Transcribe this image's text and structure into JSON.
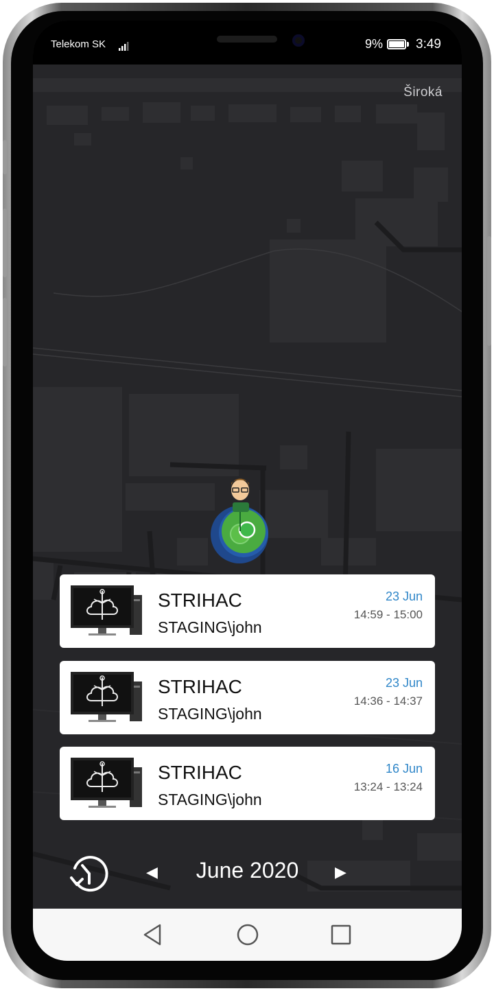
{
  "status_bar": {
    "carrier": "Telekom SK",
    "battery_percent": "9%",
    "time": "3:49",
    "icons": [
      "signal-icon",
      "battery-icon"
    ]
  },
  "map": {
    "street_label": "Široká",
    "marker_icon": "user-avatar-icon"
  },
  "sessions": [
    {
      "name": "STRIHAC",
      "user": "STAGING\\john",
      "date": "23 Jun",
      "time": "14:59 - 15:00",
      "icon": "computer-cloud-icon"
    },
    {
      "name": "STRIHAC",
      "user": "STAGING\\john",
      "date": "23 Jun",
      "time": "14:36 - 14:37",
      "icon": "computer-cloud-icon"
    },
    {
      "name": "STRIHAC",
      "user": "STAGING\\john",
      "date": "16 Jun",
      "time": "13:24 - 13:24",
      "icon": "computer-cloud-icon"
    }
  ],
  "footer": {
    "period": "June 2020",
    "prev_icon": "◀",
    "next_icon": "▶",
    "history_icon": "history-icon"
  },
  "colors": {
    "map_background": "#262629",
    "date_accent": "#2f86c8",
    "marker_green": "#4caf3a",
    "marker_blue": "#1e4f9e"
  }
}
